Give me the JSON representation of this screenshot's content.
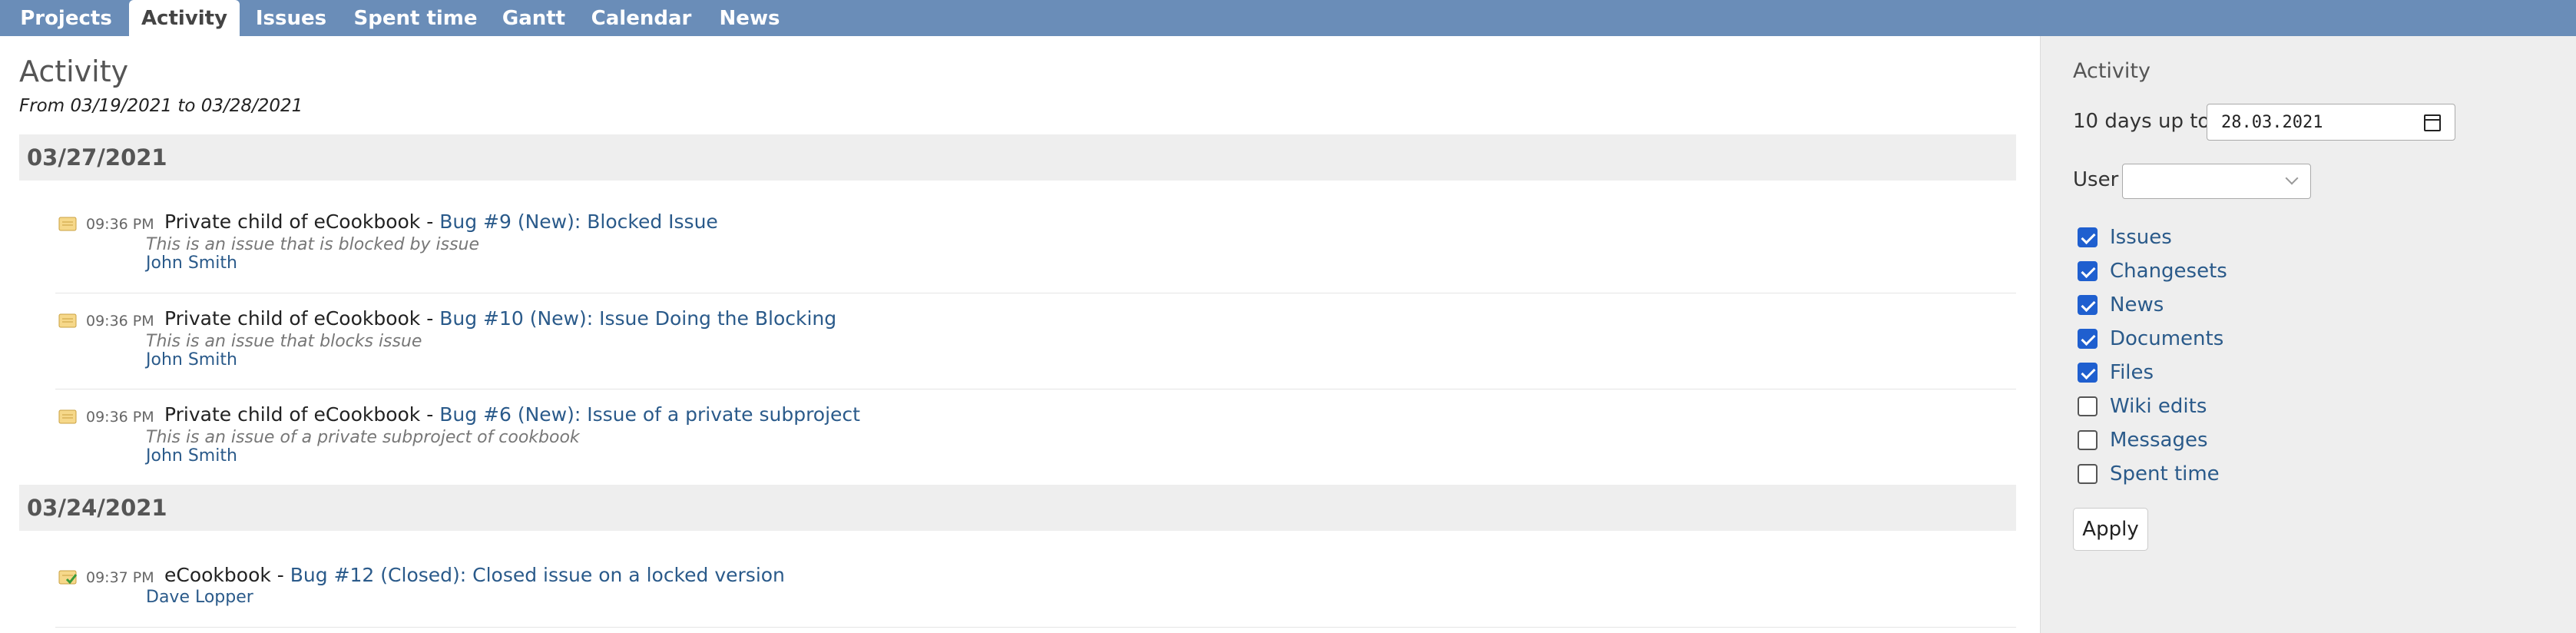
{
  "nav": {
    "tabs": [
      {
        "label": "Projects"
      },
      {
        "label": "Activity",
        "active": true
      },
      {
        "label": "Issues"
      },
      {
        "label": "Spent time"
      },
      {
        "label": "Gantt"
      },
      {
        "label": "Calendar"
      },
      {
        "label": "News"
      }
    ]
  },
  "main": {
    "title": "Activity",
    "range": "From 03/19/2021 to 03/28/2021",
    "days": [
      {
        "date": "03/27/2021",
        "entries": [
          {
            "icon": "issue-icon",
            "time": "09:36 PM",
            "project": "Private child of eCookbook - ",
            "link": "Bug #9 (New): Blocked Issue",
            "desc": "This is an issue that is blocked by issue",
            "author": "John Smith"
          },
          {
            "icon": "issue-icon",
            "time": "09:36 PM",
            "project": "Private child of eCookbook - ",
            "link": "Bug #10 (New): Issue Doing the Blocking",
            "desc": "This is an issue that blocks issue",
            "author": "John Smith"
          },
          {
            "icon": "issue-icon",
            "time": "09:36 PM",
            "project": "Private child of eCookbook - ",
            "link": "Bug #6 (New): Issue of a private subproject",
            "desc": "This is an issue of a private subproject of cookbook",
            "author": "John Smith"
          }
        ]
      },
      {
        "date": "03/24/2021",
        "entries": [
          {
            "icon": "issue-closed-icon",
            "time": "09:37 PM",
            "project": "eCookbook - ",
            "link": "Bug #12 (Closed): Closed issue on a locked version",
            "desc": "",
            "author": "Dave Lopper"
          }
        ]
      }
    ]
  },
  "sidebar": {
    "title": "Activity",
    "days_label": "10 days up to",
    "date_value": "28.03.2021",
    "user_label": "User",
    "user_value": "",
    "filters": [
      {
        "label": "Issues",
        "checked": true
      },
      {
        "label": "Changesets",
        "checked": true
      },
      {
        "label": "News",
        "checked": true
      },
      {
        "label": "Documents",
        "checked": true
      },
      {
        "label": "Files",
        "checked": true
      },
      {
        "label": "Wiki edits",
        "checked": false
      },
      {
        "label": "Messages",
        "checked": false
      },
      {
        "label": "Spent time",
        "checked": false
      }
    ],
    "apply_label": "Apply"
  },
  "colors": {
    "nav_bg": "#6a8db8",
    "link": "#2a5a8a",
    "checkbox_checked": "#1f5fcf"
  }
}
